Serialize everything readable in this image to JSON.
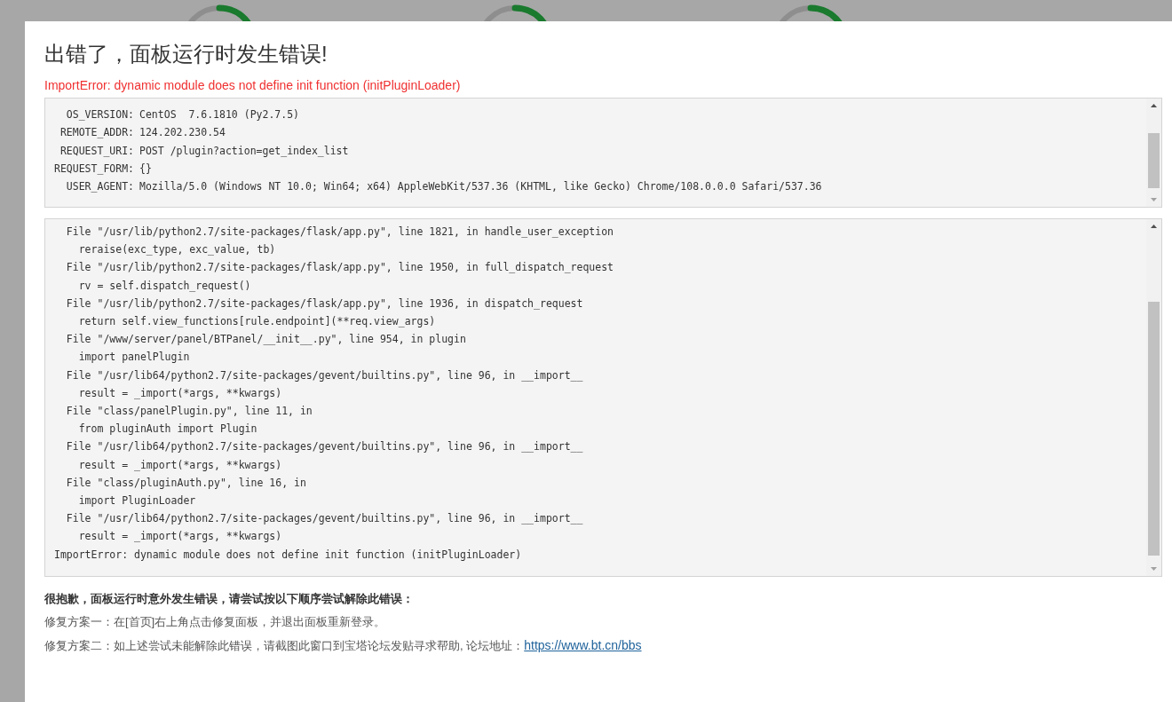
{
  "dialog": {
    "title": "出错了，面板运行时发生错误!",
    "error_message": "ImportError: dynamic module does not define init function (initPluginLoader)",
    "environment": [
      {
        "key": "OS_VERSION:",
        "value": "CentOS  7.6.1810 (Py2.7.5)"
      },
      {
        "key": "REMOTE_ADDR:",
        "value": "124.202.230.54"
      },
      {
        "key": "REQUEST_URI:",
        "value": "POST /plugin?action=get_index_list"
      },
      {
        "key": "REQUEST_FORM:",
        "value": "{}"
      },
      {
        "key": "USER_AGENT:",
        "value": "Mozilla/5.0 (Windows NT 10.0; Win64; x64) AppleWebKit/537.36 (KHTML, like Gecko) Chrome/108.0.0.0 Safari/537.36"
      }
    ],
    "traceback": [
      {
        "kind": "file",
        "text": "File \"/usr/lib/python2.7/site-packages/flask/app.py\", line 1821, in handle_user_exception"
      },
      {
        "kind": "code",
        "text": "reraise(exc_type, exc_value, tb)"
      },
      {
        "kind": "file",
        "text": "File \"/usr/lib/python2.7/site-packages/flask/app.py\", line 1950, in full_dispatch_request"
      },
      {
        "kind": "code",
        "text": "rv = self.dispatch_request()"
      },
      {
        "kind": "file",
        "text": "File \"/usr/lib/python2.7/site-packages/flask/app.py\", line 1936, in dispatch_request"
      },
      {
        "kind": "code",
        "text": "return self.view_functions[rule.endpoint](**req.view_args)"
      },
      {
        "kind": "file",
        "text": "File \"/www/server/panel/BTPanel/__init__.py\", line 954, in plugin"
      },
      {
        "kind": "code",
        "text": "import panelPlugin"
      },
      {
        "kind": "file",
        "text": "File \"/usr/lib64/python2.7/site-packages/gevent/builtins.py\", line 96, in __import__"
      },
      {
        "kind": "code",
        "text": "result = _import(*args, **kwargs)"
      },
      {
        "kind": "file",
        "text": "File \"class/panelPlugin.py\", line 11, in"
      },
      {
        "kind": "code",
        "text": "from pluginAuth import Plugin"
      },
      {
        "kind": "file",
        "text": "File \"/usr/lib64/python2.7/site-packages/gevent/builtins.py\", line 96, in __import__"
      },
      {
        "kind": "code",
        "text": "result = _import(*args, **kwargs)"
      },
      {
        "kind": "file",
        "text": "File \"class/pluginAuth.py\", line 16, in"
      },
      {
        "kind": "code",
        "text": "import PluginLoader"
      },
      {
        "kind": "file",
        "text": "File \"/usr/lib64/python2.7/site-packages/gevent/builtins.py\", line 96, in __import__"
      },
      {
        "kind": "code",
        "text": "result = _import(*args, **kwargs)"
      },
      {
        "kind": "error",
        "text": "ImportError: dynamic module does not define init function (initPluginLoader)"
      }
    ],
    "apology": "很抱歉，面板运行时意外发生错误，请尝试按以下顺序尝试解除此错误：",
    "fixes": [
      {
        "text": "修复方案一：在[首页]右上角点击修复面板，并退出面板重新登录。"
      },
      {
        "text": "修复方案二：如上述尝试未能解除此错误，请截图此窗口到宝塔论坛发贴寻求帮助, 论坛地址：",
        "link": "https://www.bt.cn/bbs"
      }
    ]
  }
}
